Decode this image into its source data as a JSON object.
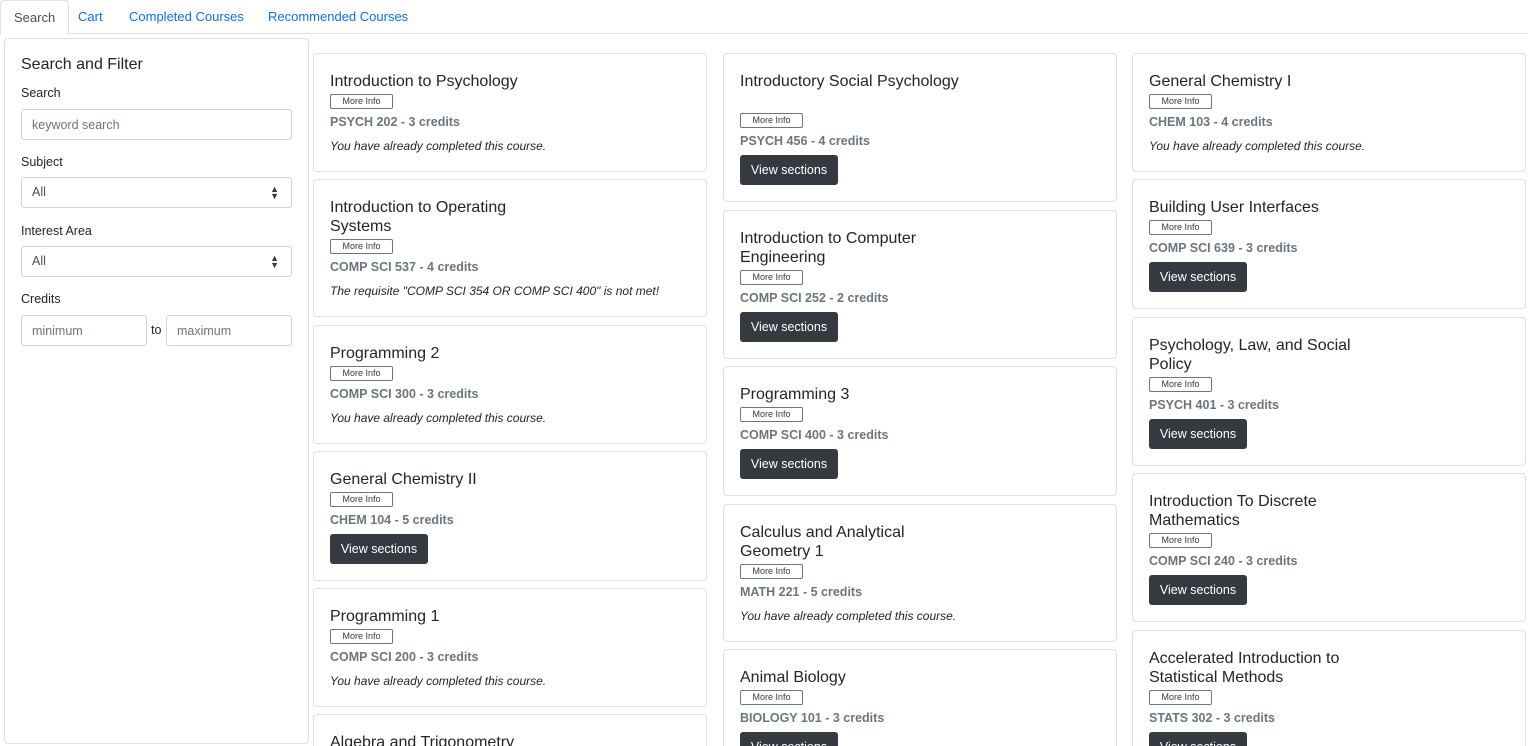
{
  "tabs": [
    {
      "label": "Search",
      "active": true
    },
    {
      "label": "Cart",
      "active": false
    },
    {
      "label": "Completed Courses",
      "active": false
    },
    {
      "label": "Recommended Courses",
      "active": false
    }
  ],
  "sidebar": {
    "title": "Search and Filter",
    "search_label": "Search",
    "search_placeholder": "keyword search",
    "subject_label": "Subject",
    "subject_value": "All",
    "interest_label": "Interest Area",
    "interest_value": "All",
    "credits_label": "Credits",
    "min_placeholder": "minimum",
    "to_label": "to",
    "max_placeholder": "maximum"
  },
  "more_info_label": "More Info",
  "view_sections_label": "View sections",
  "columns": [
    [
      {
        "title": "Introduction to Psychology",
        "code": "PSYCH 202 - 3 credits",
        "note": "You have already completed this course."
      },
      {
        "title": "Introduction to Operating Systems",
        "code": "COMP SCI 537 - 4 credits",
        "note": "The requisite \"COMP SCI 354 OR COMP SCI 400\" is not met!"
      },
      {
        "title": "Programming 2",
        "code": "COMP SCI 300 - 3 credits",
        "note": "You have already completed this course."
      },
      {
        "title": "General Chemistry II",
        "code": "CHEM 104 - 5 credits",
        "note": ""
      },
      {
        "title": "Programming 1",
        "code": "COMP SCI 200 - 3 credits",
        "note": "You have already completed this course."
      },
      {
        "title": "Algebra and Trigonometry",
        "code": "",
        "note": ""
      }
    ],
    [
      {
        "title": "Introductory Social Psychology",
        "code": "PSYCH 456 - 4 credits",
        "note": ""
      },
      {
        "title": "Introduction to Computer Engineering",
        "code": "COMP SCI 252 - 2 credits",
        "note": ""
      },
      {
        "title": "Programming 3",
        "code": "COMP SCI 400 - 3 credits",
        "note": ""
      },
      {
        "title": "Calculus and Analytical Geometry 1",
        "code": "MATH 221 - 5 credits",
        "note": "You have already completed this course."
      },
      {
        "title": "Animal Biology",
        "code": "BIOLOGY 101 - 3 credits",
        "note": ""
      }
    ],
    [
      {
        "title": "General Chemistry I",
        "code": "CHEM 103 - 4 credits",
        "note": "You have already completed this course."
      },
      {
        "title": "Building User Interfaces",
        "code": "COMP SCI 639 - 3 credits",
        "note": ""
      },
      {
        "title": "Psychology, Law, and Social Policy",
        "code": "PSYCH 401 - 3 credits",
        "note": ""
      },
      {
        "title": "Introduction To Discrete Mathematics",
        "code": "COMP SCI 240 - 3 credits",
        "note": ""
      },
      {
        "title": "Accelerated Introduction to Statistical Methods",
        "code": "STATS 302 - 3 credits",
        "note": ""
      }
    ]
  ]
}
